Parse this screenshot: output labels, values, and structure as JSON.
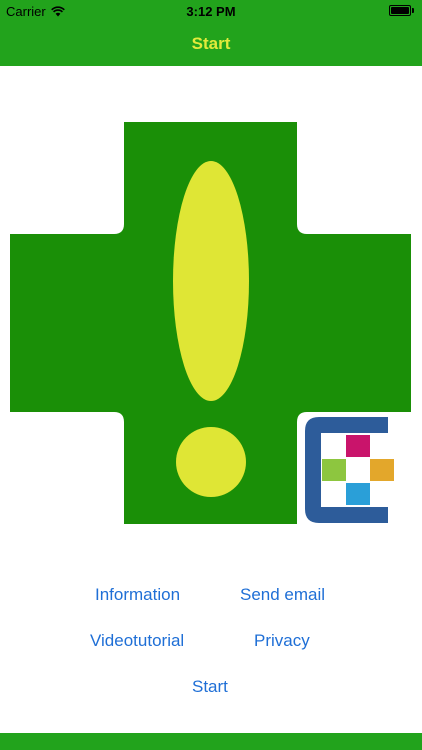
{
  "status_bar": {
    "carrier": "Carrier",
    "time": "3:12 PM",
    "wifi_icon": "wifi-icon",
    "battery_icon": "battery-icon"
  },
  "nav": {
    "title": "Start"
  },
  "colors": {
    "bar_green": "#22a31c",
    "cross_green": "#1a8f07",
    "exclamation_yellow": "#dfe635",
    "title_yellow": "#e2ea3b",
    "link_blue": "#1f6fd6",
    "logo_blue": "#2d5c9a",
    "logo_magenta": "#c9146b",
    "logo_lime": "#8dc63f",
    "logo_orange": "#e3a72b",
    "logo_cyan": "#2a9fd8"
  },
  "hero": {
    "cross_icon": "pharmacy-cross-icon",
    "exclamation_icon": "exclamation-icon",
    "logo_icon": "app-logo-icon"
  },
  "links": {
    "information": "Information",
    "send_email": "Send email",
    "videotutorial": "Videotutorial",
    "privacy": "Privacy",
    "start": "Start"
  }
}
